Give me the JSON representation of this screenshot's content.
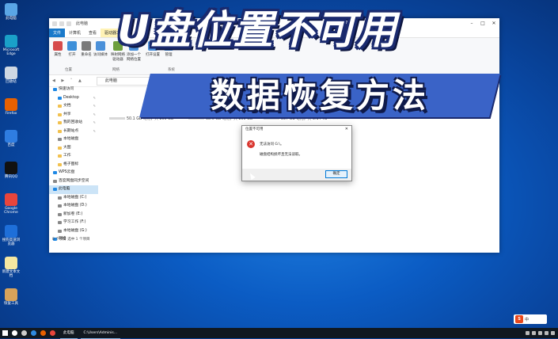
{
  "banner": {
    "title": "U盘位置不可用",
    "subtitle": "数据恢复方法"
  },
  "desktop_icons": [
    {
      "label": "此电脑",
      "icon": "this-pc-icon",
      "color": "#5aa6e6"
    },
    {
      "label": "Microsoft Edge",
      "icon": "edge-icon",
      "color": "#1aa0c8"
    },
    {
      "label": "回收站",
      "icon": "recycle-bin-icon",
      "color": "#cfd8e3"
    },
    {
      "label": "Firefox",
      "icon": "firefox-icon",
      "color": "#e66000"
    },
    {
      "label": "百度",
      "icon": "star-app-icon",
      "color": "#2f7de1"
    },
    {
      "label": "腾讯QQ",
      "icon": "qq-icon",
      "color": "#111111"
    },
    {
      "label": "Google Chrome",
      "icon": "chrome-icon",
      "color": "#e8453c"
    },
    {
      "label": "搜狗高速浏览器",
      "icon": "sogou-browser-icon",
      "color": "#1e6fd9"
    },
    {
      "label": "新建文本文档",
      "icon": "file-icon",
      "color": "#f5e7a1"
    },
    {
      "label": "恢复工具",
      "icon": "app-icon",
      "color": "#d8a35a"
    }
  ],
  "explorer": {
    "quick_access_title": "此电脑",
    "tabs": [
      "文件",
      "计算机",
      "查看",
      "驱动器工具"
    ],
    "manage_tab": "管理",
    "ribbon_buttons": [
      "属性",
      "打开",
      "重命名",
      "访问媒体",
      "映射网络驱动器",
      "添加一个网络位置",
      "打开设置",
      "管理"
    ],
    "ribbon_groups": [
      "位置",
      "网络",
      "系统"
    ],
    "address": "此电脑",
    "nav_items": [
      {
        "label": "快速访问",
        "type": "blue",
        "level": 0,
        "pinned": false
      },
      {
        "label": "Desktop",
        "type": "blue",
        "level": 1,
        "pinned": true
      },
      {
        "label": "文档",
        "type": "folder",
        "level": 1,
        "pinned": true
      },
      {
        "label": "共享",
        "type": "folder",
        "level": 1,
        "pinned": true
      },
      {
        "label": "我的回收站",
        "type": "folder",
        "level": 1,
        "pinned": true
      },
      {
        "label": "长期站点",
        "type": "folder",
        "level": 1,
        "pinned": true
      },
      {
        "label": "本地磁盘",
        "type": "gray",
        "level": 1,
        "pinned": false
      },
      {
        "label": "大图",
        "type": "folder",
        "level": 1,
        "pinned": false
      },
      {
        "label": "工作",
        "type": "folder",
        "level": 1,
        "pinned": false
      },
      {
        "label": "格子图标",
        "type": "folder",
        "level": 1,
        "pinned": false
      },
      {
        "label": "WPS云盘",
        "type": "blue",
        "level": 0,
        "pinned": false
      },
      {
        "label": "百度网盘同步空间",
        "type": "gray",
        "level": 0,
        "pinned": false
      },
      {
        "label": "此电脑",
        "type": "blue",
        "level": 0,
        "pinned": false,
        "selected": true
      },
      {
        "label": "本地磁盘 (C:)",
        "type": "gray",
        "level": 1,
        "pinned": false
      },
      {
        "label": "本地磁盘 (D:)",
        "type": "gray",
        "level": 1,
        "pinned": false
      },
      {
        "label": "新加卷 (E:)",
        "type": "gray",
        "level": 1,
        "pinned": false
      },
      {
        "label": "学习工作 (F:)",
        "type": "gray",
        "level": 1,
        "pinned": false
      },
      {
        "label": "本地磁盘 (G:)",
        "type": "gray",
        "level": 1,
        "pinned": false
      },
      {
        "label": "网络",
        "type": "blue",
        "level": 0,
        "pinned": false
      }
    ],
    "drives": [
      {
        "label": "50.1 GB 可用，共 200 GB"
      },
      {
        "label": "38.6 GB 可用，共 200 GB"
      },
      {
        "label": "837 GB 可用，共 3.14 TB"
      },
      {
        "label": ""
      }
    ],
    "status": "8 个项目    选中 1 个项目"
  },
  "dialog": {
    "title": "位置不可用",
    "message1": "无法访问 G:\\。",
    "message2": "磁盘结构损坏且无法读取。",
    "ok": "确定"
  },
  "taskbar": {
    "apps": [
      {
        "icon": "windows-start-icon",
        "color": "#ffffff"
      },
      {
        "icon": "search-icon",
        "color": "#ffffff"
      },
      {
        "icon": "task-view-icon",
        "color": "#cccccc"
      },
      {
        "icon": "app-blue-icon",
        "color": "#2f8ae0"
      },
      {
        "icon": "firefox-icon",
        "color": "#e66000"
      },
      {
        "icon": "chrome-icon",
        "color": "#e8453c"
      }
    ],
    "explorer_label": "此电脑",
    "path_label": "C:\\Users\\Adminis...",
    "ime": "中"
  }
}
